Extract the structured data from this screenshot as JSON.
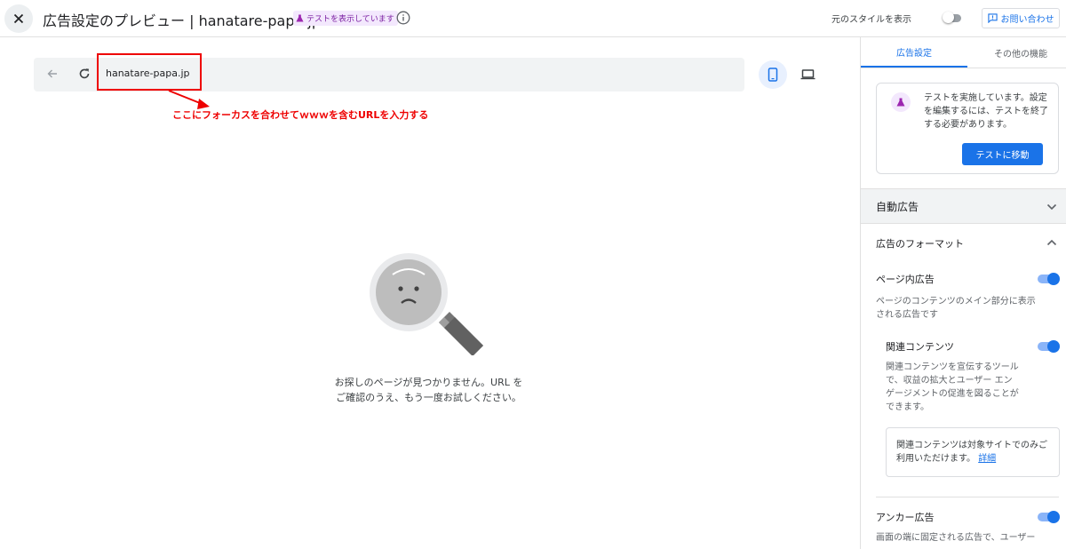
{
  "header": {
    "title": "広告設定のプレビュー | hanatare-papa.jp",
    "test_badge": "テストを表示しています",
    "original_style_label": "元のスタイルを表示",
    "contact_label": "お問い合わせ"
  },
  "browser": {
    "url": "hanatare-papa.jp",
    "annotation": "ここにフォーカスを合わせてｗｗｗを含むURLを入力する"
  },
  "empty_state": {
    "line1": "お探しのページが見つかりません。URL を",
    "line2": "ご確認のうえ、もう一度お試しください。"
  },
  "panel": {
    "tabs": [
      "広告設定",
      "その他の機能"
    ],
    "test_card": {
      "text": "テストを実施しています。設定を編集するには、テストを終了する必要があります。",
      "button": "テストに移動"
    },
    "auto_ads": "自動広告",
    "ad_formats": "広告のフォーマット",
    "in_page": {
      "label": "ページ内広告",
      "desc": "ページのコンテンツのメイン部分に表示される広告です",
      "enabled": true
    },
    "related": {
      "label": "関連コンテンツ",
      "desc": "関連コンテンツを宣伝するツールで、収益の拡大とユーザー エンゲージメントの促進を図ることができます。",
      "enabled": true,
      "note": "関連コンテンツは対象サイトでのみご利用いただけます。",
      "note_link": "詳細"
    },
    "anchor": {
      "label": "アンカー広告",
      "desc": "画面の端に固定される広告で、ユーザー",
      "enabled": true
    }
  },
  "colors": {
    "accent": "#1a73e8",
    "annotation": "#ee0000",
    "badge_bg": "#f3e8fd",
    "badge_text": "#7b1fa2"
  },
  "icons": [
    "close-icon",
    "flask-icon",
    "info-icon",
    "feedback-icon",
    "back-arrow-icon",
    "reload-icon",
    "mobile-icon",
    "desktop-icon",
    "chevron-down-icon",
    "chevron-up-icon"
  ]
}
